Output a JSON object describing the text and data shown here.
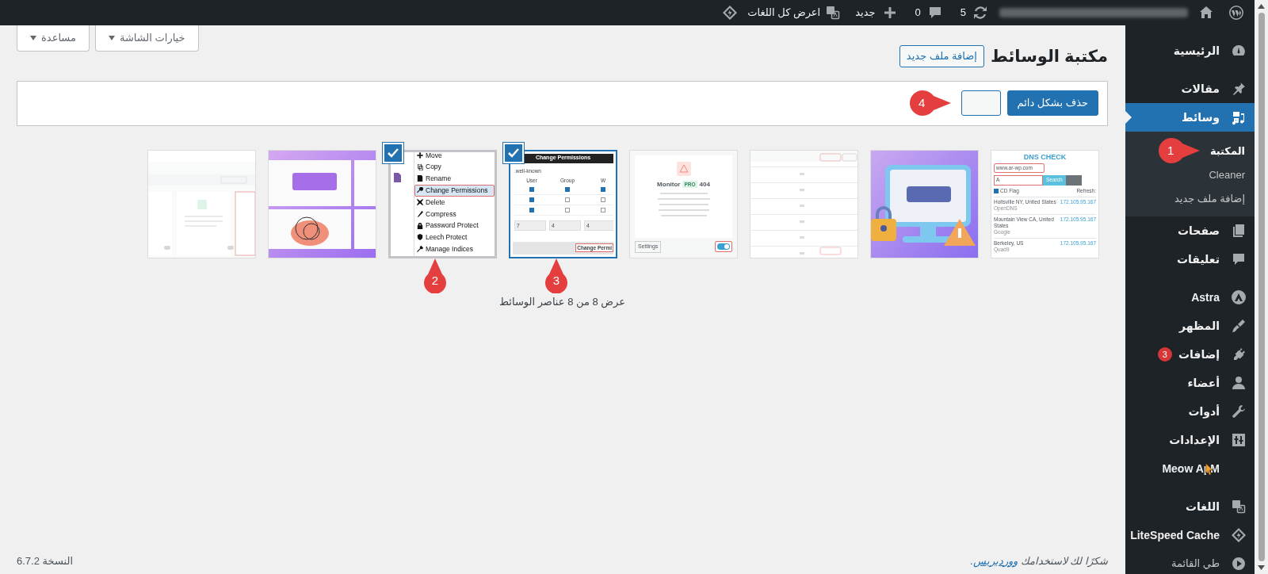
{
  "admin_bar": {
    "updates": "5",
    "comments": "0",
    "new_label": "جديد",
    "languages_label": "اعرض كل اللغات"
  },
  "sidebar": {
    "sections": [
      {
        "items": [
          {
            "label": "الرئيسية",
            "selected": false
          }
        ]
      },
      {
        "items": [
          {
            "label": "مقالات",
            "selected": false
          },
          {
            "label": "وسائط",
            "selected": true,
            "expanded": true,
            "children": [
              {
                "label": "المكتبة",
                "selected": true
              },
              {
                "label": "Cleaner",
                "selected": false
              },
              {
                "label": "إضافة ملف جديد",
                "selected": false
              }
            ]
          },
          {
            "label": "صفحات",
            "selected": false
          },
          {
            "label": "تعليقات",
            "selected": false
          }
        ]
      },
      {
        "items": [
          {
            "label": "Astra",
            "selected": false
          },
          {
            "label": "المظهر",
            "selected": false
          },
          {
            "label": "إضافات",
            "selected": false,
            "badge": "3"
          },
          {
            "label": "أعضاء",
            "selected": false
          },
          {
            "label": "أدوات",
            "selected": false
          },
          {
            "label": "الإعدادات",
            "selected": false
          },
          {
            "label": "Meow ApM",
            "selected": false
          }
        ]
      },
      {
        "items": [
          {
            "label": "اللغات",
            "selected": false
          },
          {
            "label": "LiteSpeed Cache",
            "selected": false
          },
          {
            "label": "طي القائمة",
            "selected": false
          }
        ]
      }
    ]
  },
  "screen_meta": {
    "buttons": [
      {
        "label": "خيارات الشاشة"
      },
      {
        "label": "مساعدة"
      }
    ]
  },
  "page": {
    "title": "مكتبة الوسائط",
    "add_new": "إضافة ملف جديد"
  },
  "bulk_bar": {
    "delete_button": "حذف بشكل دائم"
  },
  "thumbnails": [
    {
      "kind": "dns",
      "selected": false,
      "focused": false,
      "title": "DNS CHECK",
      "domain": "www.ar-wp.com",
      "record": "A",
      "button": "Search",
      "flag": "CD Flag",
      "refresh": "Refresh:",
      "rows": [
        {
          "location": "Holtsville NY, United States",
          "ip": "172.105.95.167",
          "provider": "OpenDNS"
        },
        {
          "location": "Mountain View CA, United States",
          "ip": "172.105.95.167",
          "provider": "Google"
        },
        {
          "location": "Berkeley, US",
          "ip": "172.105.95.167",
          "provider": "Quad9"
        }
      ]
    },
    {
      "kind": "picture",
      "selected": false,
      "focused": false
    },
    {
      "kind": "log",
      "selected": false,
      "focused": false
    },
    {
      "kind": "monitor",
      "selected": false,
      "focused": false,
      "title": "Monitor",
      "tag": "PRO",
      "code": "404",
      "button": "Settings",
      "on": true
    },
    {
      "kind": "permissions",
      "selected": true,
      "focused": true,
      "title": "Change Permissions",
      "folder": ".well-known",
      "columns": [
        "W",
        "Group",
        "User"
      ],
      "rows": [
        {
          "checked": [
            true,
            true,
            true
          ]
        },
        {
          "checked": [
            false,
            false,
            true
          ]
        },
        {
          "checked": [
            false,
            false,
            true
          ]
        }
      ],
      "values": [
        "4",
        "4",
        "7"
      ],
      "button": "Change Permi"
    },
    {
      "kind": "menu",
      "selected": true,
      "focused": false,
      "items": [
        {
          "label": "Move",
          "selected": false
        },
        {
          "label": "Copy",
          "selected": false
        },
        {
          "label": "Rename",
          "selected": false
        },
        {
          "label": "Change Permissions",
          "selected": true
        },
        {
          "label": "Delete",
          "selected": false
        },
        {
          "label": "Compress",
          "selected": false
        },
        {
          "label": "Password Protect",
          "selected": false
        },
        {
          "label": "Leech Protect",
          "selected": false
        },
        {
          "label": "Manage Indices",
          "selected": false
        }
      ]
    },
    {
      "kind": "banner",
      "selected": false,
      "focused": false
    },
    {
      "kind": "settings",
      "selected": false,
      "focused": false
    }
  ],
  "count_text": "عرض 8 من 8 عناصر الوسائط",
  "footer": {
    "thanks": "شكرًا لك لاستخدامك",
    "link": "ووردبريس",
    "end": ".",
    "version": "النسخة 6.7.2"
  },
  "callouts": [
    {
      "number": "1"
    },
    {
      "number": "2"
    },
    {
      "number": "3"
    },
    {
      "number": "4"
    }
  ]
}
